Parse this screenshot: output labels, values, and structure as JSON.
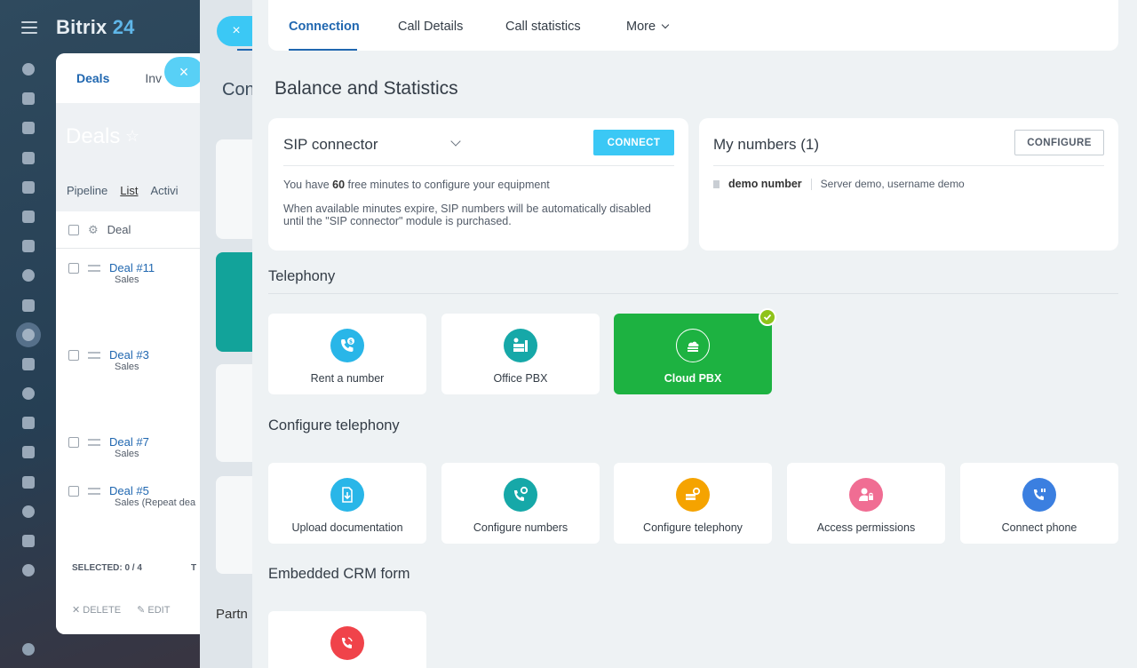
{
  "background": {
    "brand_name": "Bitrix",
    "brand_num": "24",
    "top_tabs": [
      "Deals",
      "Inv"
    ],
    "page_title": "Deals",
    "subnav": [
      "Pipeline",
      "List",
      "Activi"
    ],
    "table_header": "Deal",
    "rows": [
      {
        "name": "Deal #11",
        "stage": "Sales"
      },
      {
        "name": "Deal #3",
        "stage": "Sales"
      },
      {
        "name": "Deal #7",
        "stage": "Sales"
      },
      {
        "name": "Deal #5",
        "stage": "Sales (Repeat dea"
      }
    ],
    "selected": "SELECTED: 0 / 4",
    "total": "T",
    "actions": [
      "DELETE",
      "EDIT"
    ],
    "mid_title": "Con",
    "mid_bottom": "Partn"
  },
  "close_glyph": "×",
  "tabs": [
    {
      "label": "Connection",
      "active": true
    },
    {
      "label": "Call Details",
      "active": false
    },
    {
      "label": "Call statistics",
      "active": false
    },
    {
      "label": "More",
      "active": false
    }
  ],
  "page_title": "Balance and Statistics",
  "sip": {
    "title": "SIP connector",
    "button": "CONNECT",
    "line1_pre": "You have ",
    "line1_num": "60",
    "line1_post": " free minutes to configure your equipment",
    "line2": "When available minutes expire, SIP numbers will be automatically disabled",
    "line3": "until the \"SIP connector\" module is purchased."
  },
  "numbers": {
    "title": "My numbers (1)",
    "button": "CONFIGURE",
    "number_name": "demo number",
    "number_desc": "Server demo, username demo"
  },
  "sections": {
    "telephony": "Telephony",
    "configure": "Configure telephony",
    "crm_form": "Embedded CRM form"
  },
  "telephony_tiles": [
    {
      "label": "Rent a number",
      "icon": "phone-dollar-icon",
      "color": "#29b6e8"
    },
    {
      "label": "Office PBX",
      "icon": "pbx-server-icon",
      "color": "#16a8a8"
    },
    {
      "label": "Cloud PBX",
      "icon": "cloud-server-icon",
      "color": "#1db241",
      "selected": true
    }
  ],
  "configure_tiles": [
    {
      "label": "Upload documentation",
      "icon": "upload-doc-icon",
      "color": "#29b6e8"
    },
    {
      "label": "Configure numbers",
      "icon": "phone-gear-icon",
      "color": "#16a8a8"
    },
    {
      "label": "Configure telephony",
      "icon": "server-gear-icon",
      "color": "#f5a300"
    },
    {
      "label": "Access permissions",
      "icon": "user-lock-icon",
      "color": "#f06d93"
    },
    {
      "label": "Connect phone",
      "icon": "phone-plug-icon",
      "color": "#3b7fe0"
    }
  ],
  "crm_tiles": [
    {
      "label": "",
      "icon": "phone-call-icon",
      "color": "#f0434a"
    }
  ],
  "colors": {
    "accent": "#2067b0",
    "connect": "#3bc8f5",
    "selected_tile": "#1db241",
    "check": "#8fc31a"
  }
}
